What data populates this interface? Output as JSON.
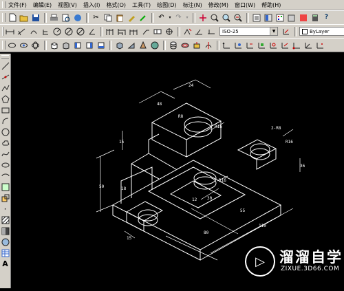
{
  "menubar": {
    "items": [
      {
        "label": "文件(F)"
      },
      {
        "label": "编辑(E)"
      },
      {
        "label": "视图(V)"
      },
      {
        "label": "插入(I)"
      },
      {
        "label": "格式(O)"
      },
      {
        "label": "工具(T)"
      },
      {
        "label": "绘图(D)"
      },
      {
        "label": "标注(N)"
      },
      {
        "label": "修改(M)"
      },
      {
        "label": "窗口(W)"
      },
      {
        "label": "帮助(H)"
      }
    ]
  },
  "dimstyle": {
    "value": "ISO-25"
  },
  "layer": {
    "value": "ByLayer"
  },
  "drawing": {
    "dims": {
      "d1": "48",
      "d2": "24",
      "d3": "R8",
      "d4": "R16",
      "d5": "2-R8",
      "d6": "R16",
      "d7": "R16",
      "d8": "50",
      "d9": "15",
      "d10": "18",
      "d11": "55",
      "d12": "30",
      "d13": "110",
      "d14": "80",
      "d15": "36",
      "d16": "15",
      "d17": "12"
    }
  },
  "watermark": {
    "brand": "溜溜自学",
    "url": "ZIXUE.3D66.COM"
  }
}
